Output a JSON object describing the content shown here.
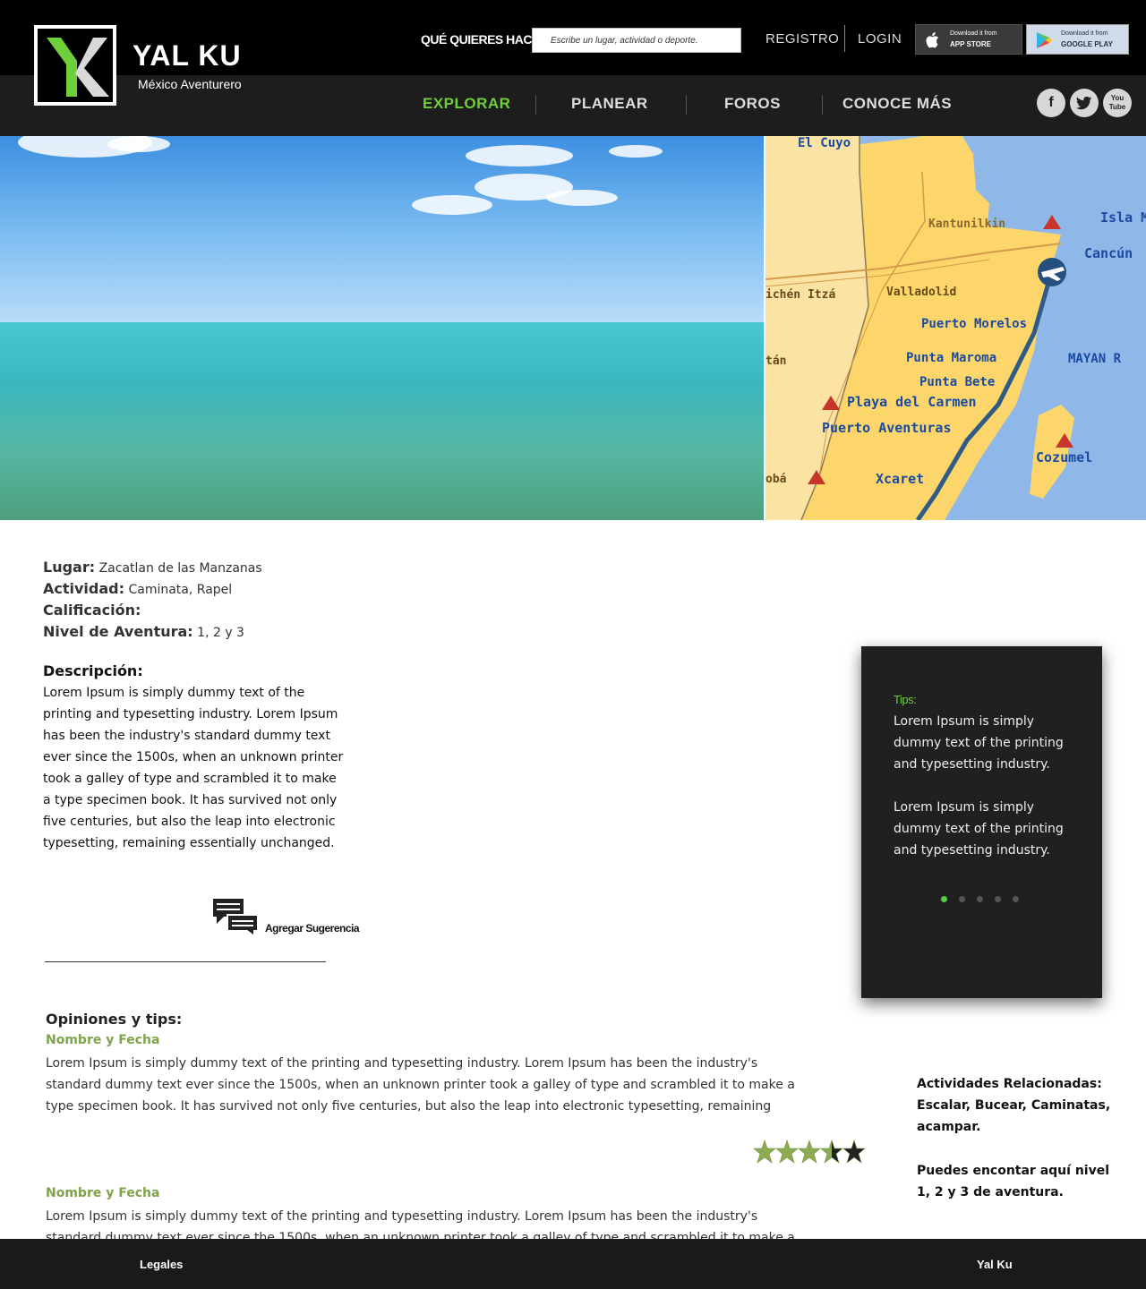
{
  "brand": {
    "name": "YAL KU",
    "tagline": "México Aventurero",
    "accent": "#6fcf3a"
  },
  "header": {
    "search_label": "QUÉ QUIERES HACER?",
    "search_placeholder": "Escribe un lugar, actividad o deporte.",
    "registro": "REGISTRO",
    "login": "LOGIN",
    "app_store": {
      "small": "Download it from",
      "big": "APP STORE"
    },
    "google_play": {
      "small": "Download it from",
      "big": "GOOGLE PLAY"
    }
  },
  "nav": {
    "items": [
      "EXPLORAR",
      "PLANEAR",
      "FOROS",
      "CONOCE MÁS"
    ],
    "active": "EXPLORAR",
    "social": [
      {
        "icon": "facebook-icon",
        "glyph": "f"
      },
      {
        "icon": "twitter-icon",
        "glyph": "t"
      },
      {
        "icon": "youtube-icon",
        "glyph": "You Tube"
      }
    ]
  },
  "map": {
    "places": [
      "El Cuyo",
      "Kantunilkin",
      "Isla M",
      "Cancún",
      "ichén Itzá",
      "Valladolid",
      "Puerto Morelos",
      "Punta Maroma",
      "MAYAN R",
      "tán",
      "Punta Bete",
      "Playa del Carmen",
      "Puerto Aventuras",
      "Cozumel",
      "obá",
      "Xcaret"
    ]
  },
  "details": {
    "lugar_label": "Lugar:",
    "lugar_value": "Zacatlan de las Manzanas",
    "actividad_label": "Actividad:",
    "actividad_value": "Caminata, Rapel",
    "calificacion_label": "Calificación:",
    "nivel_label": "Nivel de Aventura:",
    "nivel_value": "1, 2 y 3",
    "descripcion_label": "Descripción:",
    "descripcion_text": "Lorem Ipsum is simply dummy text of the printing and typesetting industry. Lorem Ipsum has been the industry's standard dummy text ever since the 1500s, when an unknown printer took a galley of type and scrambled it to make a type specimen book. It has survived not only five centuries, but also the leap into electronic typesetting, remaining essentially unchanged.",
    "suggest_label": "Agregar Sugerencia"
  },
  "tips": {
    "label": "Tips:",
    "paragraph_1": "Lorem Ipsum is simply dummy text of the printing and typesetting industry.",
    "paragraph_2": "Lorem Ipsum is simply dummy text of the printing and typesetting industry.",
    "dots": 5,
    "active_dot": 1
  },
  "opinions": {
    "title": "Opiniones y tips:",
    "items": [
      {
        "name": "Nombre y Fecha",
        "text": "Lorem Ipsum is simply dummy text of the printing and typesetting industry. Lorem Ipsum has been the industry's standard dummy text ever since the 1500s, when an unknown printer took a galley of type and scrambled it to make a type specimen book. It has survived not only five centuries, but also the leap into electronic typesetting, remaining",
        "rating": 3.5,
        "rating_max": 5
      },
      {
        "name": "Nombre y Fecha",
        "text": "Lorem Ipsum is simply dummy text of the printing and typesetting industry. Lorem Ipsum has been the industry's standard dummy text ever since the 1500s, when an unknown printer took a galley of type and scrambled it to make a"
      }
    ]
  },
  "related": {
    "title": "Actividades Relacionadas:",
    "activities": "Escalar, Bucear, Caminatas, acampar.",
    "levels": "Puedes encontar aquí nivel 1, 2 y 3 de aventura."
  },
  "footer": {
    "legales": "Legales",
    "brand": "Yal Ku"
  }
}
